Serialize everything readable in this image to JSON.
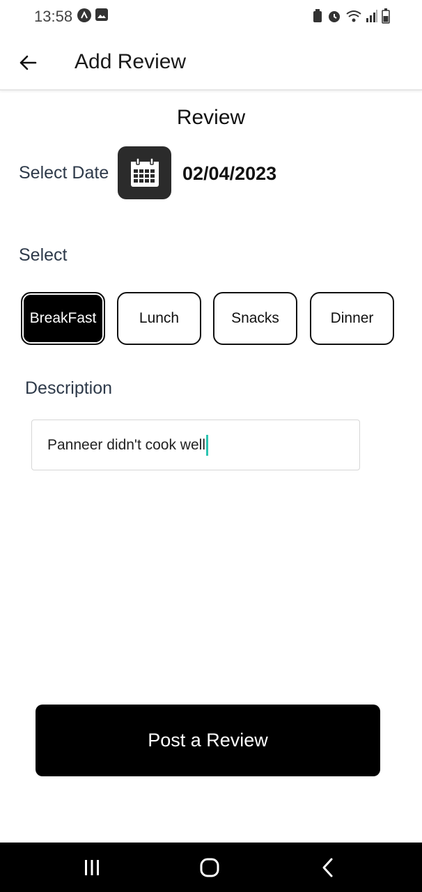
{
  "status_bar": {
    "time": "13:58",
    "left_icons": [
      "app-notification-icon",
      "image-icon"
    ],
    "right_icons": [
      "battery-saver-icon",
      "alarm-icon",
      "wifi-icon",
      "signal-icon",
      "battery-icon"
    ]
  },
  "app_bar": {
    "back_icon": "arrow-left-icon",
    "title": "Add Review"
  },
  "form": {
    "heading": "Review",
    "date_label": "Select Date",
    "calendar_icon": "calendar-icon",
    "date_value": "02/04/2023",
    "select_label": "Select",
    "meal_options": [
      {
        "label": "BreakFast",
        "selected": true
      },
      {
        "label": "Lunch",
        "selected": false
      },
      {
        "label": "Snacks",
        "selected": false
      },
      {
        "label": "Dinner",
        "selected": false
      }
    ],
    "description_label": "Description",
    "description_value": "Panneer didn't cook well",
    "submit_label": "Post a Review"
  },
  "nav_bar": {
    "recents_icon": "recents-icon",
    "home_icon": "home-icon",
    "back_icon": "back-chevron-icon"
  },
  "colors": {
    "primary": "#000000",
    "text": "#111111",
    "label": "#2e3a4a",
    "caret": "#2bc4b1",
    "calendar_bg": "#2b2b2b"
  }
}
